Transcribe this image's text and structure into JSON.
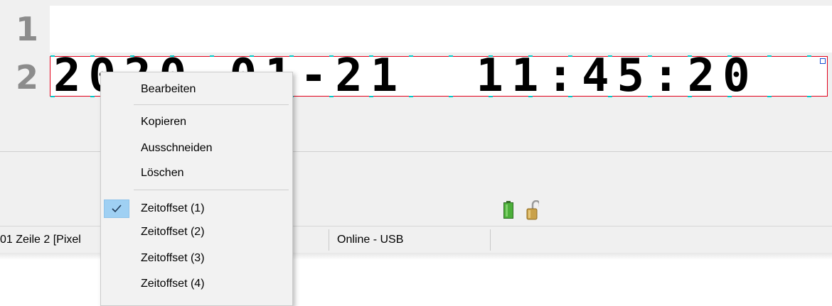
{
  "editor": {
    "line_numbers": [
      "1",
      "2"
    ],
    "line2_text": "2020-01-21  11:45:20"
  },
  "statusbar": {
    "position_text": "01 Zeile 2 [Pixel",
    "connection": "Online - USB"
  },
  "indicators": {
    "battery_icon": "battery-icon",
    "lock_icon": "unlocked-padlock-icon",
    "battery_color": "#4caf3a",
    "lock_color": "#c9a14a"
  },
  "context_menu": {
    "items": [
      {
        "label": "Bearbeiten"
      },
      {
        "label": "Kopieren"
      },
      {
        "label": "Ausschneiden"
      },
      {
        "label": "Löschen"
      },
      {
        "label": "Zeitoffset (1)",
        "checked": true
      },
      {
        "label": "Zeitoffset (2)"
      },
      {
        "label": "Zeitoffset (3)"
      },
      {
        "label": "Zeitoffset (4)"
      }
    ]
  },
  "colors": {
    "selection_border": "#e2001a",
    "marker_cyan": "#00c8c8",
    "check_highlight": "#9fd0f3"
  }
}
